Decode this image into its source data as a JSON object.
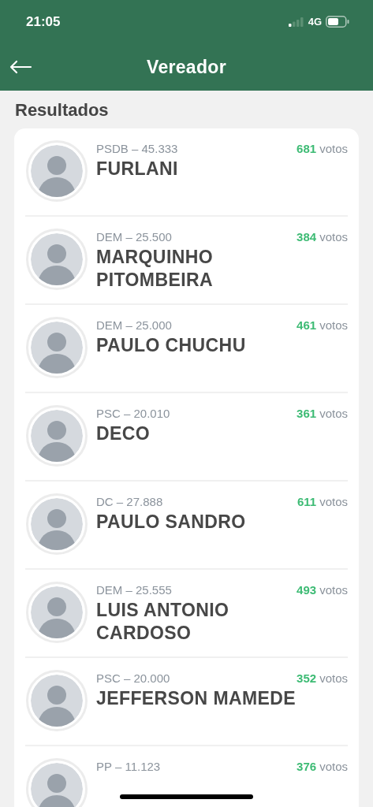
{
  "status_bar": {
    "time": "21:05",
    "network": "4G"
  },
  "header": {
    "title": "Vereador"
  },
  "section_title": "Resultados",
  "candidates": [
    {
      "party": "PSDB – 45.333",
      "name": "FURLANI",
      "votes": "681",
      "votes_label": "votos"
    },
    {
      "party": "DEM – 25.500",
      "name": "MARQUINHO PITOMBEIRA",
      "votes": "384",
      "votes_label": "votos"
    },
    {
      "party": "DEM – 25.000",
      "name": "PAULO CHUCHU",
      "votes": "461",
      "votes_label": "votos"
    },
    {
      "party": "PSC – 20.010",
      "name": "DECO",
      "votes": "361",
      "votes_label": "votos"
    },
    {
      "party": "DC – 27.888",
      "name": "PAULO SANDRO",
      "votes": "611",
      "votes_label": "votos"
    },
    {
      "party": "DEM – 25.555",
      "name": "LUIS ANTONIO CARDOSO",
      "votes": "493",
      "votes_label": "votos"
    },
    {
      "party": "PSC – 20.000",
      "name": "JEFFERSON MAMEDE",
      "votes": "352",
      "votes_label": "votos"
    },
    {
      "party": "PP – 11.123",
      "votes": "376",
      "votes_label": "votos"
    }
  ]
}
